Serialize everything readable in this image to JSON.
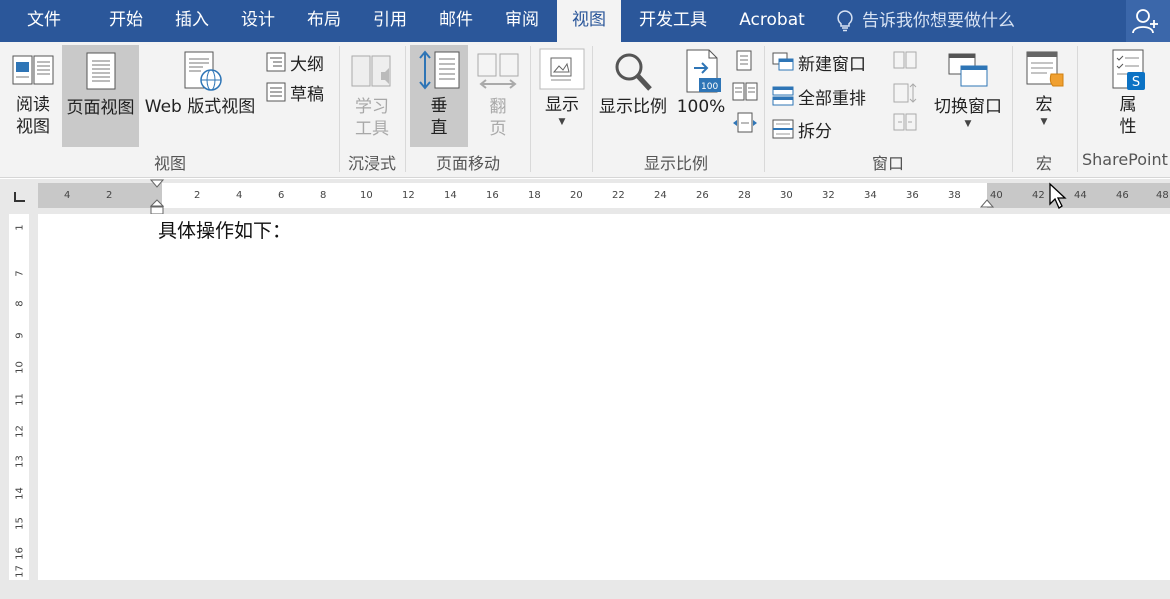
{
  "tabs": [
    "文件",
    "开始",
    "插入",
    "设计",
    "布局",
    "引用",
    "邮件",
    "审阅",
    "视图",
    "开发工具",
    "Acrobat"
  ],
  "active_tab": "视图",
  "tell_me": "告诉我你想要做什么",
  "ribbon": {
    "views": {
      "read_mode": [
        "阅读",
        "视图"
      ],
      "print_layout": "页面视图",
      "web_layout": "Web 版式视图",
      "outline": "大纲",
      "draft": "草稿",
      "group": "视图"
    },
    "immersive": {
      "learning_tools": [
        "学习",
        "工具"
      ],
      "group": "沉浸式"
    },
    "page_movement": {
      "vertical": [
        "垂",
        "直"
      ],
      "side_to_side": [
        "翻",
        "页"
      ],
      "group": "页面移动"
    },
    "show": {
      "label": "显示"
    },
    "zoom": {
      "zoom": "显示比例",
      "percent_100": "100%",
      "percent_badge": "100",
      "group": "显示比例"
    },
    "window": {
      "new_window": "新建窗口",
      "arrange_all": "全部重排",
      "split": "拆分",
      "switch_windows": "切换窗口",
      "group": "窗口"
    },
    "macros": {
      "label": "宏",
      "group": "宏"
    },
    "sharepoint": {
      "properties": [
        "属",
        "性"
      ],
      "group": "SharePoint"
    }
  },
  "ruler": {
    "left_ticks": [
      "4",
      "2"
    ],
    "right_ticks": [
      "2",
      "4",
      "6",
      "8",
      "10",
      "12",
      "14",
      "16",
      "18",
      "20",
      "22",
      "24",
      "26",
      "28",
      "30",
      "32",
      "34",
      "36",
      "38",
      "40",
      "42",
      "44",
      "46",
      "48"
    ]
  },
  "vruler": [
    "1",
    "7",
    "8",
    "9",
    "10",
    "11",
    "12",
    "13",
    "14",
    "15",
    "16",
    "17"
  ],
  "document": {
    "text": "具体操作如下："
  },
  "colors": {
    "brand": "#2b579a",
    "ribbon": "#f3f3f3",
    "accent_blue": "#2e75b6"
  }
}
